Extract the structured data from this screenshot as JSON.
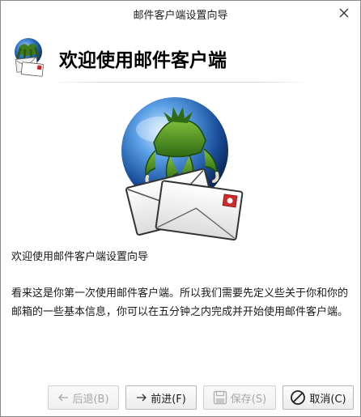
{
  "window": {
    "title": "邮件客户端设置向导"
  },
  "page": {
    "heading": "欢迎使用邮件客户端",
    "intro": "欢迎使用邮件客户端设置向导",
    "description": "看来这是你第一次使用邮件客户端。所以我们需要先定义些关于你和你的邮箱的一些基本信息，你可以在五分钟之内完成并开始使用邮件客户端。"
  },
  "buttons": {
    "back": {
      "label": "后退(B)",
      "enabled": false,
      "icon": "arrow-left-icon"
    },
    "next": {
      "label": "前进(F)",
      "enabled": true,
      "icon": "arrow-right-icon"
    },
    "save": {
      "label": "保存(S)",
      "enabled": false,
      "icon": "floppy-disk-icon"
    },
    "cancel": {
      "label": "取消(C)",
      "enabled": true,
      "icon": "cancel-circle-icon"
    }
  },
  "colors": {
    "globe_blue": "#1f5fb0",
    "claw_green": "#4f8a22",
    "envelope": "#f4f4f4"
  }
}
